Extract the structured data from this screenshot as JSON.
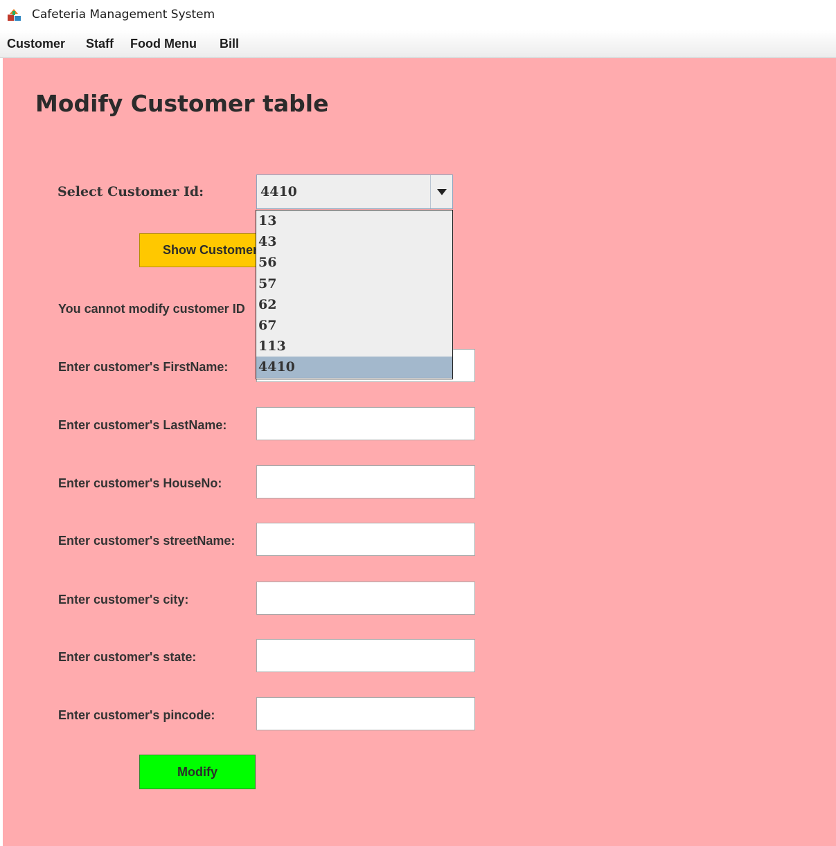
{
  "window": {
    "title": "Cafeteria Management System",
    "icon": "java-app-icon"
  },
  "menubar": {
    "items": [
      "Customer",
      "Staff",
      "Food Menu",
      "Bill"
    ]
  },
  "page": {
    "heading": "Modify Customer table",
    "select_label": "Select Customer Id:",
    "combo": {
      "value": "4410",
      "arrow_icon": "triangle-down-icon",
      "options": [
        "13",
        "43",
        "56",
        "57",
        "62",
        "67",
        "113",
        "4410"
      ],
      "selected_index": 7
    },
    "show_button_label": "Show Customer",
    "note": "You cannot modify customer ID",
    "fields": [
      {
        "label": "Enter customer's FirstName:",
        "value": ""
      },
      {
        "label": "Enter customer's LastName:",
        "value": ""
      },
      {
        "label": "Enter customer's HouseNo:",
        "value": ""
      },
      {
        "label": "Enter customer's streetName:",
        "value": ""
      },
      {
        "label": "Enter customer's city:",
        "value": ""
      },
      {
        "label": "Enter customer's state:",
        "value": ""
      },
      {
        "label": "Enter customer's pincode:",
        "value": ""
      }
    ],
    "modify_button_label": "Modify"
  },
  "colors": {
    "panel_bg": "#ffabae",
    "show_button": "#ffc800",
    "modify_button": "#00ff00",
    "selected_option": "#a3b8cc"
  }
}
